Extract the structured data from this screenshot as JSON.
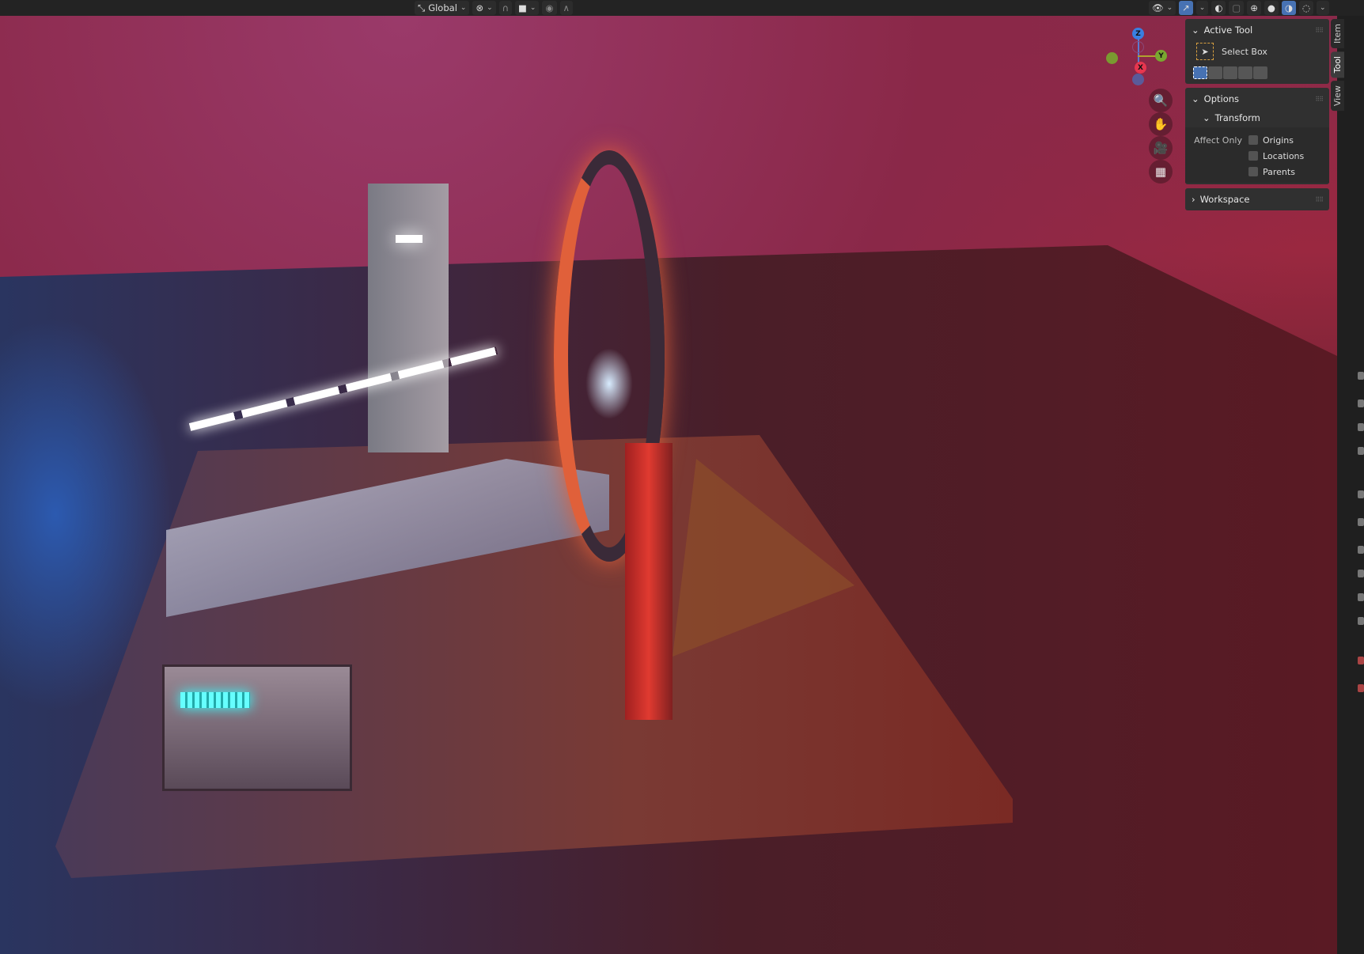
{
  "header": {
    "orientation_label": "Global",
    "icons": [
      "transform-orientation-icon",
      "pivot-icon",
      "snap-icon",
      "snap-target-icon",
      "proportional-edit-icon",
      "falloff-icon",
      "visibility-icon",
      "gizmo-icon",
      "overlay-icon",
      "xray-icon",
      "wireframe-shading-icon",
      "solid-shading-icon",
      "material-shading-icon",
      "rendered-shading-icon"
    ]
  },
  "gizmo": {
    "z": "Z",
    "y": "Y",
    "x": "X"
  },
  "npanel": {
    "active_tool": {
      "title": "Active Tool",
      "tool_name": "Select Box"
    },
    "options": {
      "title": "Options",
      "transform": "Transform",
      "affect_only": "Affect Only",
      "checkboxes": [
        {
          "label": "Origins",
          "checked": false
        },
        {
          "label": "Locations",
          "checked": false
        },
        {
          "label": "Parents",
          "checked": false
        }
      ]
    },
    "workspace": {
      "title": "Workspace"
    }
  },
  "tabs": [
    "Item",
    "Tool",
    "View"
  ],
  "colors": {
    "accent": "#4772b3",
    "x_axis": "#e8364f",
    "y_axis": "#79a830",
    "z_axis": "#3a7fe0"
  }
}
